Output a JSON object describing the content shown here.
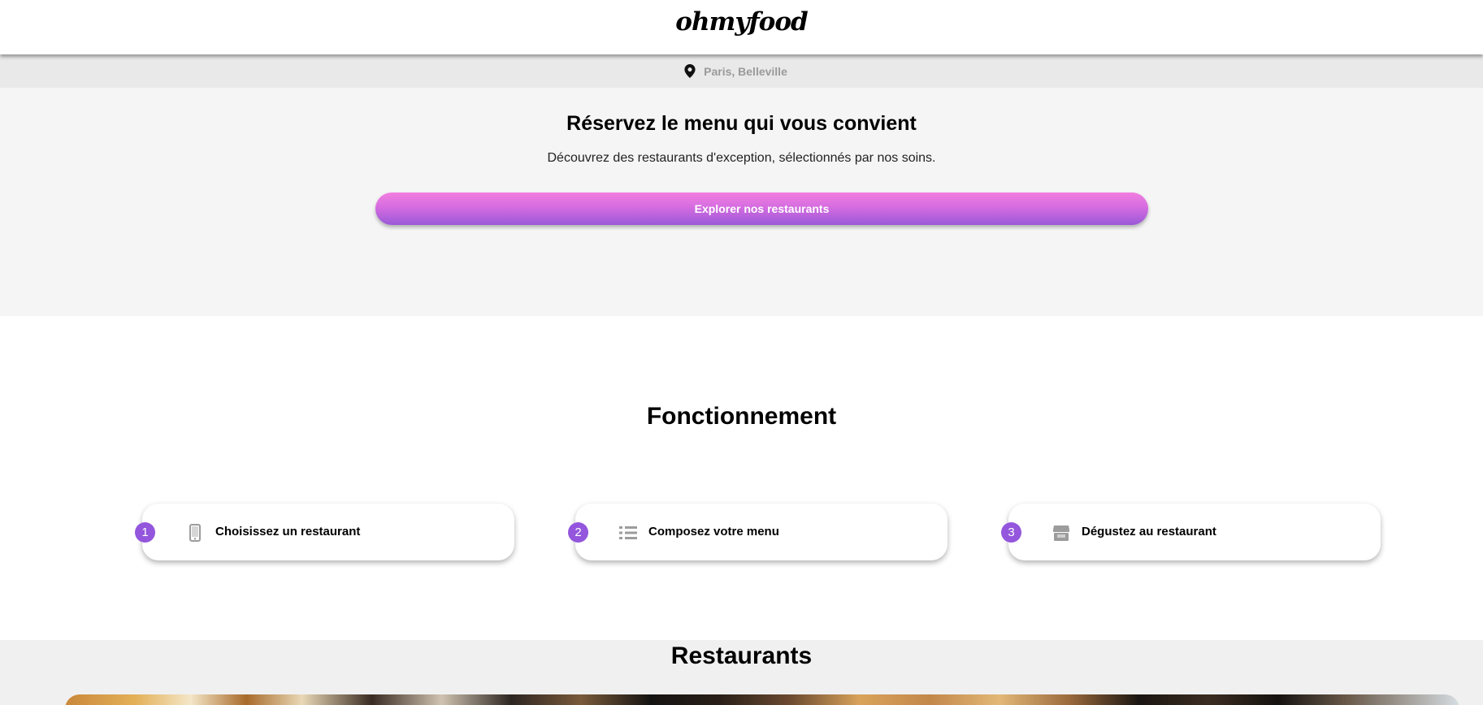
{
  "header": {
    "logo": "ohmyfood"
  },
  "location": {
    "icon": "map-pin-icon",
    "text": "Paris, Belleville"
  },
  "hero": {
    "title": "Réservez le menu qui vous convient",
    "subtitle": "Découvrez des restaurants d'exception, sélectionnés par nos soins.",
    "button_label": "Explorer nos restaurants"
  },
  "how_it_works": {
    "title": "Fonctionnement",
    "steps": [
      {
        "number": "1",
        "icon": "smartphone-icon",
        "label": "Choisissez un restaurant"
      },
      {
        "number": "2",
        "icon": "list-icon",
        "label": "Composez votre menu"
      },
      {
        "number": "3",
        "icon": "store-icon",
        "label": "Dégustez au restaurant"
      }
    ]
  },
  "restaurants": {
    "title": "Restaurants"
  },
  "colors": {
    "accent_purple": "#9356dc",
    "button_gradient_top": "#f27fe0",
    "button_gradient_bottom": "#9a59d8",
    "hero_background": "#f5f5f5",
    "location_background": "#e9e9e9"
  }
}
